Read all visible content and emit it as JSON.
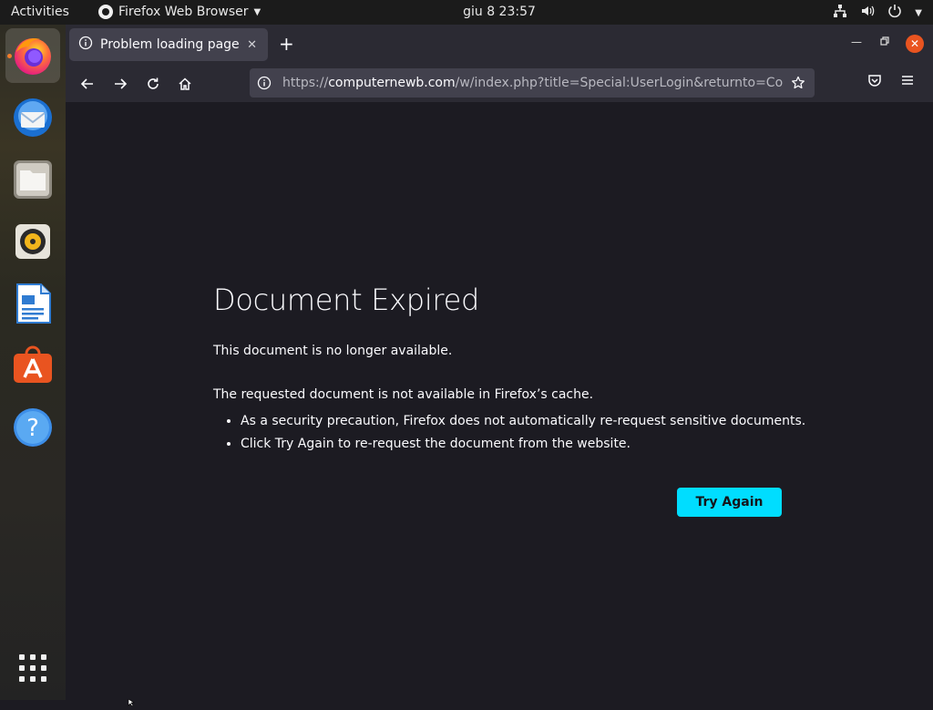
{
  "topbar": {
    "activities": "Activities",
    "app_name": "Firefox Web Browser",
    "clock": "giu 8  23:57"
  },
  "dock": {
    "items": [
      {
        "name": "Firefox",
        "icon": "firefox-icon"
      },
      {
        "name": "Thunderbird",
        "icon": "thunderbird-icon"
      },
      {
        "name": "Files",
        "icon": "files-icon"
      },
      {
        "name": "Rhythmbox",
        "icon": "rhythmbox-icon"
      },
      {
        "name": "LibreOffice Writer",
        "icon": "writer-icon"
      },
      {
        "name": "Ubuntu Software",
        "icon": "software-icon"
      },
      {
        "name": "Help",
        "icon": "help-icon"
      },
      {
        "name": "Show Applications",
        "icon": "app-grid-icon"
      }
    ]
  },
  "browser": {
    "tab_title": "Problem loading page",
    "url_scheme": "https://",
    "url_host": "computernewb.com",
    "url_rest": "/w/index.php?title=Special:UserLogin&returnto=Col"
  },
  "error": {
    "title": "Document Expired",
    "short_desc": "This document is no longer available.",
    "long_desc": "The requested document is not available in Firefox’s cache.",
    "bullets": [
      "As a security precaution, Firefox does not automatically re-request sensitive documents.",
      "Click Try Again to re-request the document from the website."
    ],
    "button_label": "Try Again"
  },
  "colors": {
    "accent": "#00ddff",
    "page_bg": "#1c1b22",
    "toolbar_bg": "#2b2a33",
    "ubuntu_orange": "#e95420"
  }
}
